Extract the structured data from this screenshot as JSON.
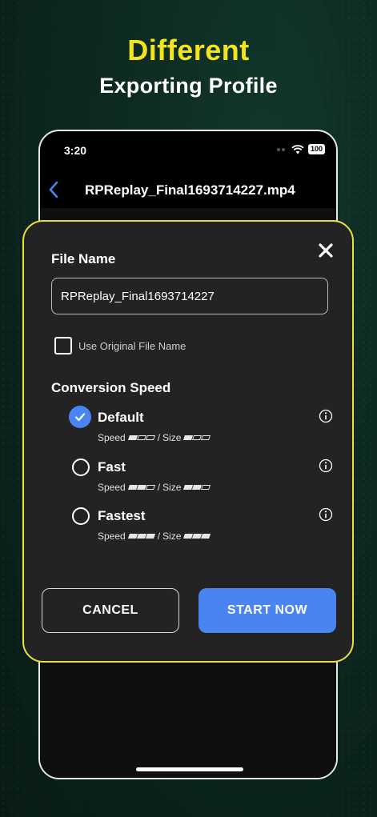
{
  "promo": {
    "headline": "Different",
    "subheadline": "Exporting Profile"
  },
  "colors": {
    "headline": "#f2e51b",
    "accent": "#4a84f0",
    "dialog_border": "#ece03a",
    "dialog_bg": "#232323"
  },
  "status_bar": {
    "time": "3:20",
    "battery": "100",
    "icons": [
      "signal-dots-icon",
      "wifi-icon",
      "battery-icon"
    ]
  },
  "nav": {
    "back_icon": "chevron-left-icon",
    "title": "RPReplay_Final1693714227.mp4"
  },
  "dialog": {
    "close_icon": "close-icon",
    "file_name_label": "File Name",
    "file_name_value": "RPReplay_Final1693714227",
    "use_original_label": "Use Original File Name",
    "use_original_checked": false,
    "conversion_speed_label": "Conversion Speed",
    "options": [
      {
        "name": "Default",
        "speed_label": "Speed",
        "separator": "/",
        "size_label": "Size",
        "speed_level": 1,
        "size_level": 1,
        "max_level": 3,
        "selected": true,
        "info_icon": "info-icon"
      },
      {
        "name": "Fast",
        "speed_label": "Speed",
        "separator": "/",
        "size_label": "Size",
        "speed_level": 2,
        "size_level": 2,
        "max_level": 3,
        "selected": false,
        "info_icon": "info-icon"
      },
      {
        "name": "Fastest",
        "speed_label": "Speed",
        "separator": "/",
        "size_label": "Size",
        "speed_level": 3,
        "size_level": 3,
        "max_level": 3,
        "selected": false,
        "info_icon": "info-icon"
      }
    ],
    "cancel_label": "CANCEL",
    "start_label": "START NOW"
  }
}
